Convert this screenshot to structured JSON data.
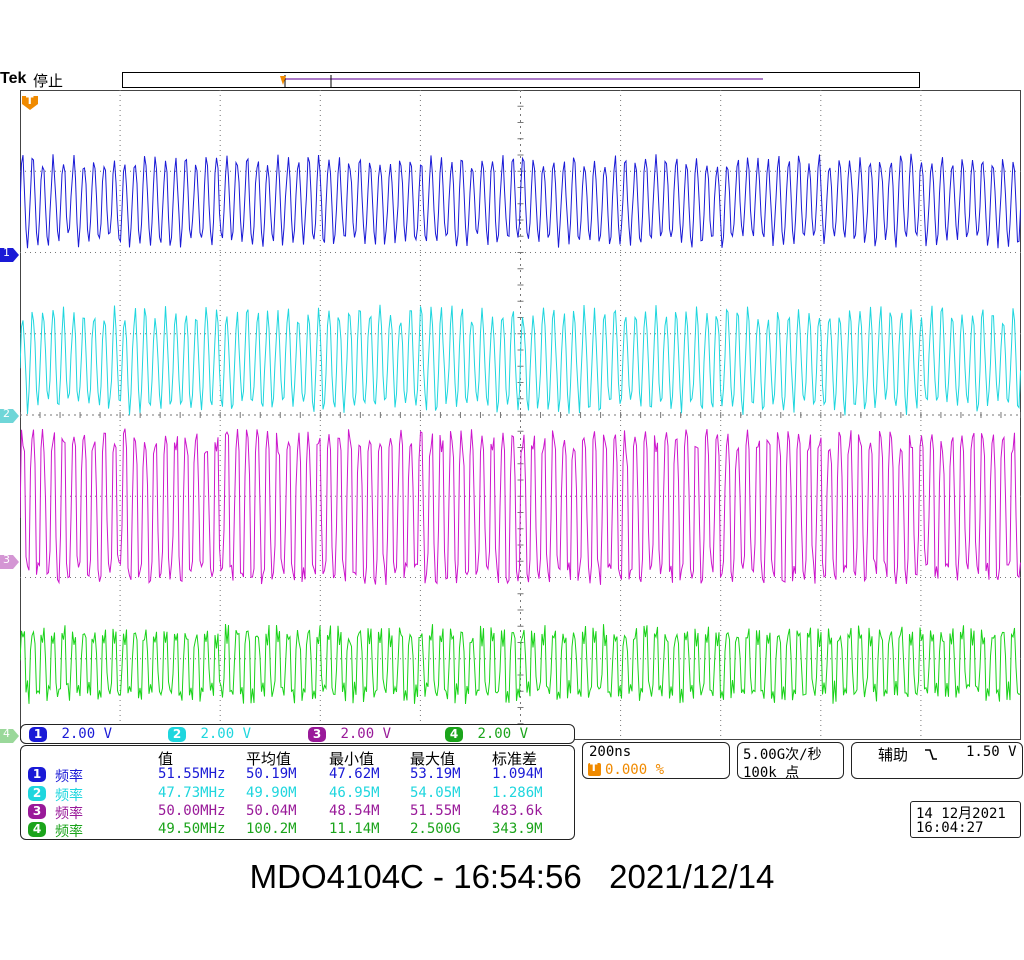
{
  "header": {
    "brand": "Tek",
    "status": "停止"
  },
  "trigger_marker": "T",
  "colors": {
    "ch1": "#1a1ad6",
    "ch2": "#1fd6de",
    "ch3": "#cc18cc",
    "ch4": "#1ad21a",
    "trigger": "#f08a00",
    "grid": "#777777"
  },
  "channels": [
    {
      "num": "1",
      "scale": "2.00 V"
    },
    {
      "num": "2",
      "scale": "2.00 V"
    },
    {
      "num": "3",
      "scale": "2.00 V"
    },
    {
      "num": "4",
      "scale": "2.00 V"
    }
  ],
  "measurements": {
    "headers": [
      "值",
      "平均值",
      "最小值",
      "最大值",
      "标准差"
    ],
    "rows": [
      {
        "ch": "1",
        "label": "频率",
        "value": "51.55MHz",
        "mean": "50.19M",
        "min": "47.62M",
        "max": "53.19M",
        "std": "1.094M"
      },
      {
        "ch": "2",
        "label": "频率",
        "value": "47.73MHz",
        "mean": "49.90M",
        "min": "46.95M",
        "max": "54.05M",
        "std": "1.286M"
      },
      {
        "ch": "3",
        "label": "频率",
        "value": "50.00MHz",
        "mean": "50.04M",
        "min": "48.54M",
        "max": "51.55M",
        "std": "483.6k"
      },
      {
        "ch": "4",
        "label": "频率",
        "value": "49.50MHz",
        "mean": "100.2M",
        "min": "11.14M",
        "max": "2.500G",
        "std": "343.9M"
      }
    ]
  },
  "horizontal": {
    "scale": "200ns",
    "position": "0.000 %"
  },
  "acquisition": {
    "sample_rate": "5.00G次/秒",
    "record_length": "100k 点"
  },
  "trigger": {
    "source": "辅助",
    "slope_icon": "falling-edge-icon",
    "level": "1.50 V"
  },
  "datetime": {
    "date": "14 12月2021",
    "time": "16:04:27"
  },
  "footer": {
    "caption": "MDO4104C - 16:54:56   2021/12/14"
  }
}
